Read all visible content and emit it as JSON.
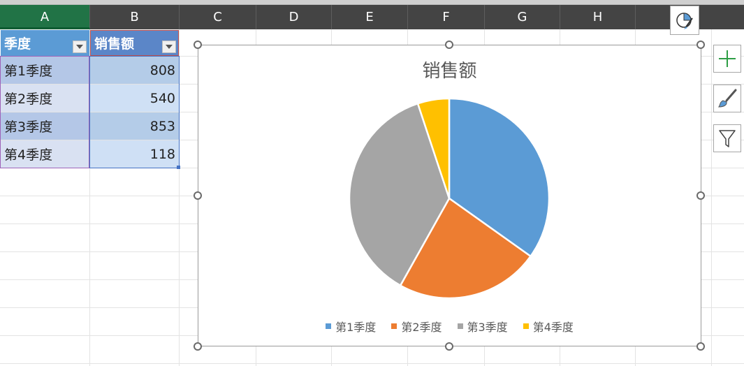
{
  "columns": [
    "A",
    "B",
    "C",
    "D",
    "E",
    "F",
    "G",
    "H"
  ],
  "table": {
    "headers": [
      "季度",
      "销售额"
    ],
    "rows": [
      [
        "第1季度",
        "808"
      ],
      [
        "第2季度",
        "540"
      ],
      [
        "第3季度",
        "853"
      ],
      [
        "第4季度",
        "118"
      ]
    ]
  },
  "chart_data": {
    "type": "pie",
    "title": "销售额",
    "categories": [
      "第1季度",
      "第2季度",
      "第3季度",
      "第4季度"
    ],
    "values": [
      808,
      540,
      853,
      118
    ],
    "colors": [
      "#5b9bd5",
      "#ed7d31",
      "#a5a5a5",
      "#ffc000"
    ],
    "legend": "bottom"
  },
  "icons": {
    "chart_quick_layout": "chart-quick-layout-icon",
    "chart_elements": "plus-icon",
    "chart_styles": "paintbrush-icon",
    "chart_filters": "funnel-icon"
  }
}
